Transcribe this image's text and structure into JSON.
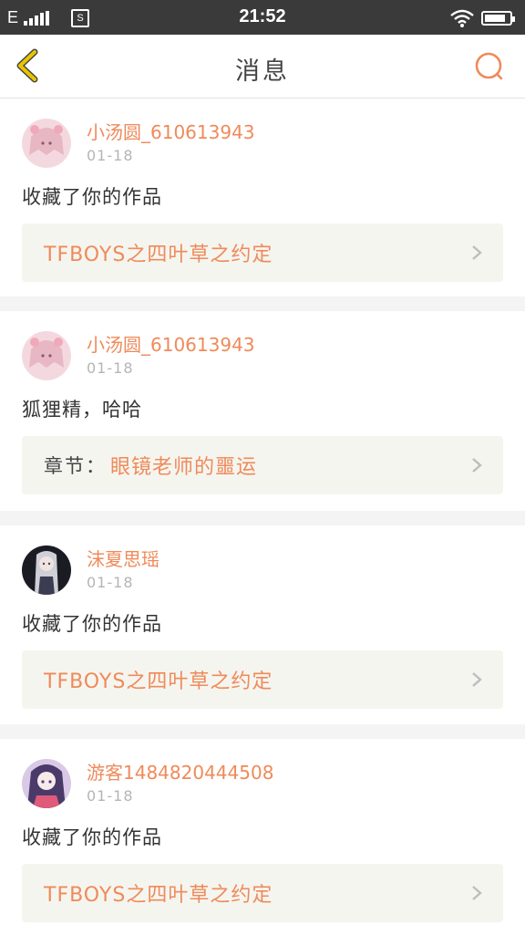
{
  "status_bar": {
    "carrier": "E",
    "sim_label": "S",
    "time": "21:52",
    "battery_level": 0.85
  },
  "nav": {
    "title": "消息"
  },
  "colors": {
    "accent": "#ef8a5a",
    "back_arrow": "#e8c500",
    "card_ref_bg": "#f5f5ef"
  },
  "messages": [
    {
      "username": "小汤圆_610613943",
      "date": "01-18",
      "text": "收藏了你的作品",
      "ref_prefix": "",
      "ref_title": "TFBOYS之四叶草之约定",
      "avatar_icon": "anime-girl-pink-avatar-icon"
    },
    {
      "username": "小汤圆_610613943",
      "date": "01-18",
      "text": "狐狸精，哈哈",
      "ref_prefix": "章节：",
      "ref_title": "眼镜老师的噩运",
      "avatar_icon": "anime-girl-pink-avatar-icon"
    },
    {
      "username": "沫夏思瑶",
      "date": "01-18",
      "text": "收藏了你的作品",
      "ref_prefix": "",
      "ref_title": "TFBOYS之四叶草之约定",
      "avatar_icon": "anime-girl-dark-avatar-icon"
    },
    {
      "username": "游客1484820444508",
      "date": "01-18",
      "text": "收藏了你的作品",
      "ref_prefix": "",
      "ref_title": "TFBOYS之四叶草之约定",
      "avatar_icon": "anime-girl-purple-avatar-icon"
    }
  ]
}
